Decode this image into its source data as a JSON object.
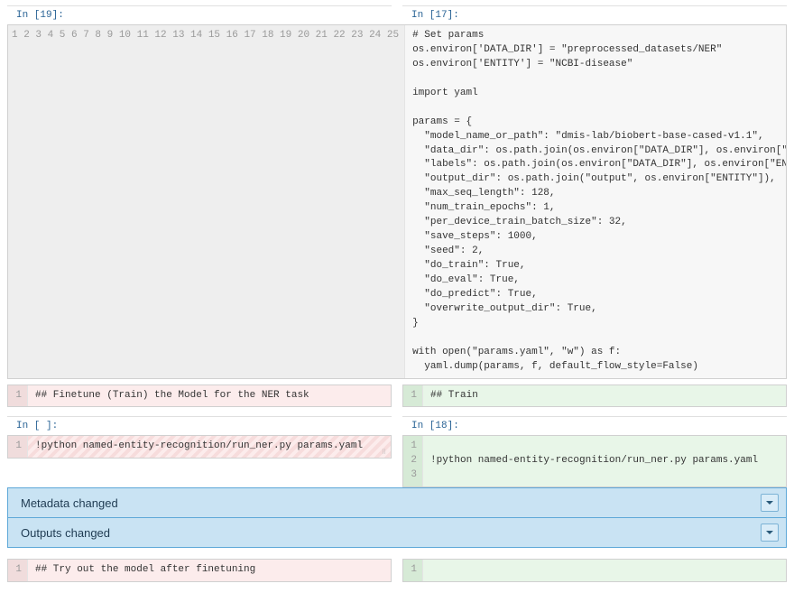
{
  "cell1": {
    "left_prompt": "In [19]:",
    "right_prompt": "In [17]:",
    "line_count": 25,
    "code": "# Set params\nos.environ['DATA_DIR'] = \"preprocessed_datasets/NER\"\nos.environ['ENTITY'] = \"NCBI-disease\"\n\nimport yaml\n\nparams = {\n  \"model_name_or_path\": \"dmis-lab/biobert-base-cased-v1.1\",\n  \"data_dir\": os.path.join(os.environ[\"DATA_DIR\"], os.environ[\"ENTITY\"]),\n  \"labels\": os.path.join(os.environ[\"DATA_DIR\"], os.environ[\"ENTITY\"], \"labels.txt\"),\n  \"output_dir\": os.path.join(\"output\", os.environ[\"ENTITY\"]),\n  \"max_seq_length\": 128,\n  \"num_train_epochs\": 1,\n  \"per_device_train_batch_size\": 32,\n  \"save_steps\": 1000,\n  \"seed\": 2,\n  \"do_train\": True,\n  \"do_eval\": True,\n  \"do_predict\": True,\n  \"overwrite_output_dir\": True,\n}\n\nwith open(\"params.yaml\", \"w\") as f:\n  yaml.dump(params, f, default_flow_style=False)\n"
  },
  "cell2": {
    "left_lines": "1",
    "left_code": "## Finetune (Train) the Model for the NER task",
    "right_lines": "1",
    "right_code": "## Train"
  },
  "cell3": {
    "left_prompt": "In [ ]:",
    "right_prompt": "In [18]:",
    "left_lines": "1",
    "left_code": "!python named-entity-recognition/run_ner.py params.yaml",
    "right_lines": "1\n2\n3",
    "right_code": "\n!python named-entity-recognition/run_ner.py params.yaml\n"
  },
  "banner1": "Metadata changed",
  "banner2": "Outputs changed",
  "cell4": {
    "left_lines": "1",
    "left_code": "## Try out the model after finetuning",
    "right_lines": "1",
    "right_code": ""
  }
}
